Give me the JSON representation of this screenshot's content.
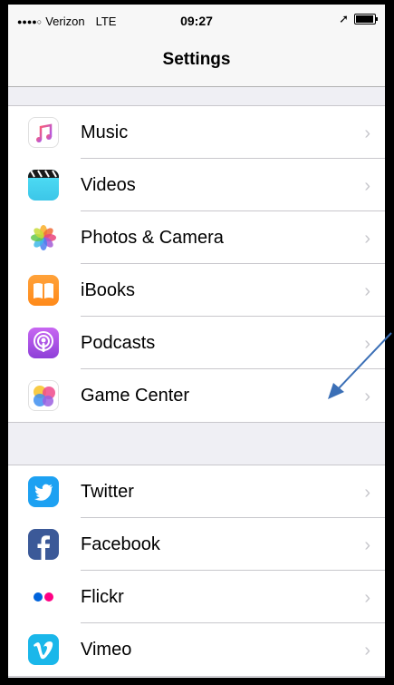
{
  "status": {
    "carrier": "Verizon",
    "network": "LTE",
    "time": "09:27"
  },
  "nav": {
    "title": "Settings"
  },
  "group1": [
    {
      "label": "Music",
      "icon": "music-icon"
    },
    {
      "label": "Videos",
      "icon": "videos-icon"
    },
    {
      "label": "Photos & Camera",
      "icon": "photos-icon"
    },
    {
      "label": "iBooks",
      "icon": "ibooks-icon"
    },
    {
      "label": "Podcasts",
      "icon": "podcasts-icon"
    },
    {
      "label": "Game Center",
      "icon": "game-center-icon"
    }
  ],
  "group2": [
    {
      "label": "Twitter",
      "icon": "twitter-icon"
    },
    {
      "label": "Facebook",
      "icon": "facebook-icon"
    },
    {
      "label": "Flickr",
      "icon": "flickr-icon"
    },
    {
      "label": "Vimeo",
      "icon": "vimeo-icon"
    }
  ],
  "colors": {
    "annotation_arrow": "#3b6fb6",
    "chevron": "#c7c7cc"
  }
}
